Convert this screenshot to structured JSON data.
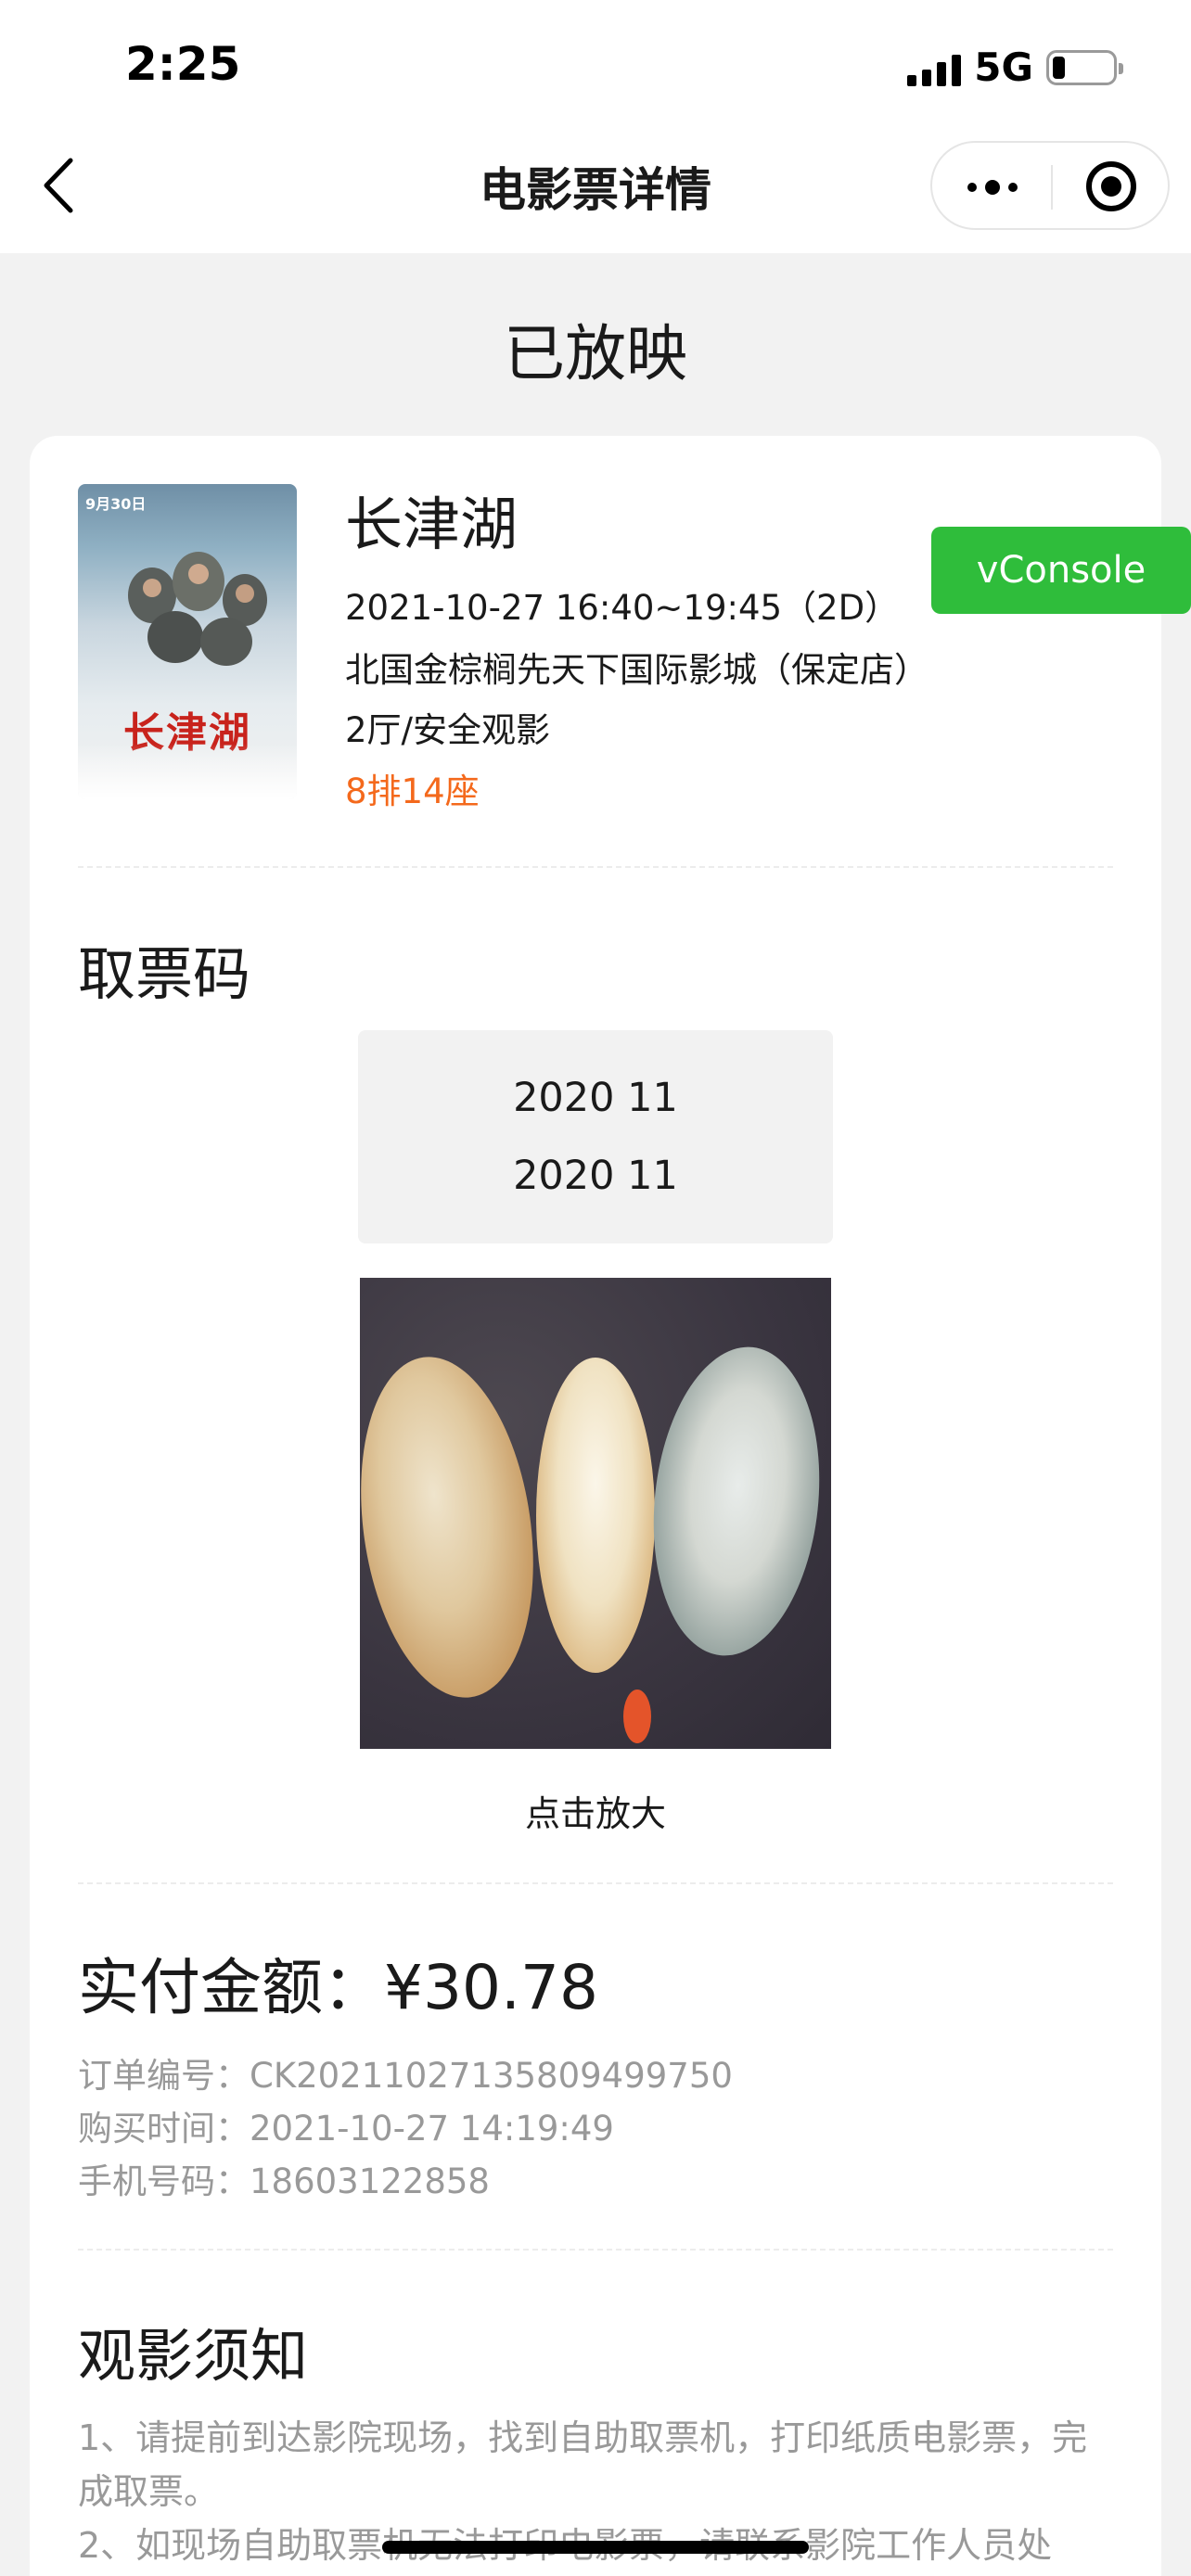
{
  "status_bar": {
    "time": "2:25",
    "network": "5G",
    "battery_level": 0.2
  },
  "nav": {
    "title": "电影票详情"
  },
  "ticket_status": "已放映",
  "movie": {
    "name": "长津湖",
    "time": "2021-10-27 16:40~19:45（2D）",
    "cinema": "北国金棕榈先天下国际影城（保定店）",
    "hall": "2厅/安全观影",
    "seat": "8排14座",
    "poster": {
      "date_tag": "9月30日",
      "title": "长津湖"
    }
  },
  "vconsole": "vConsole",
  "pickup": {
    "title": "取票码",
    "codes": [
      "2020 11",
      "2020 11"
    ],
    "zoom_label": "点击放大"
  },
  "payment": {
    "label": "实付金额：",
    "amount": "¥30.78",
    "order_no": "订单编号：CK20211027135809499750",
    "purchase_time": "购买时间：2021-10-27 14:19:49",
    "phone": "手机号码：18603122858"
  },
  "notice": {
    "title": "观影须知",
    "items": [
      "1、请提前到达影院现场，找到自助取票机，打印纸质电影票，完成取票。",
      "2、如现场自助取票机无法打印电影票，请联系影院工作人员处"
    ]
  },
  "colors": {
    "accent_orange": "#f4691c",
    "vconsole_green": "#2fbd3b",
    "muted_text": "#999999"
  }
}
